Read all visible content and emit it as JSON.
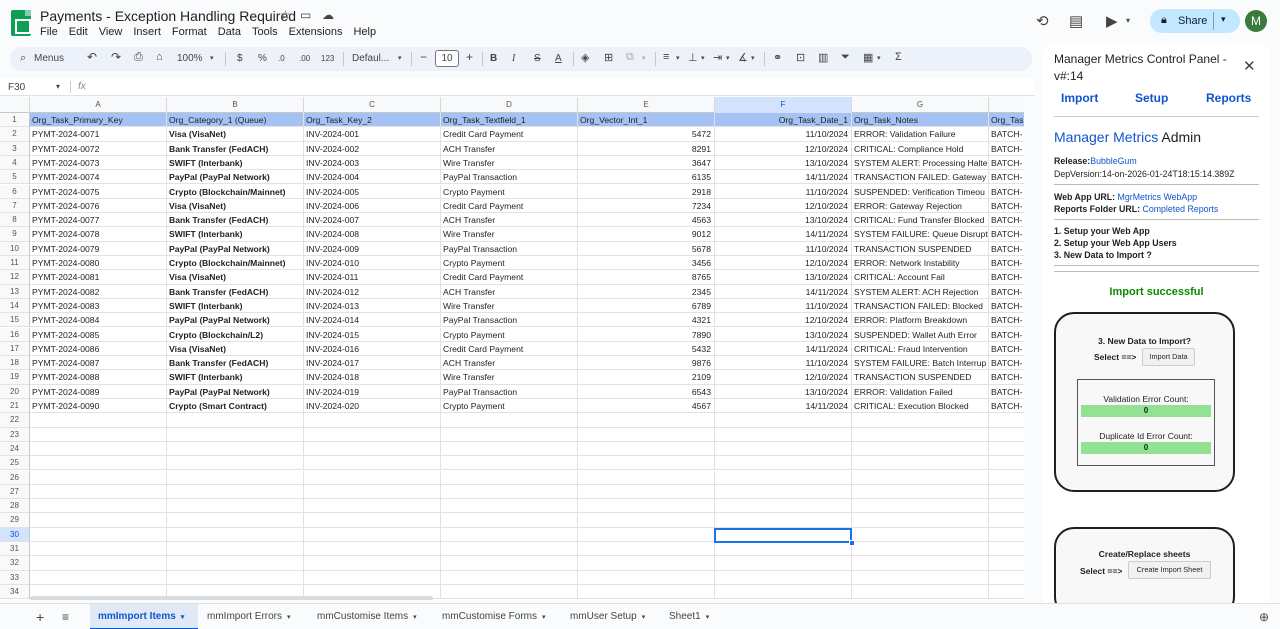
{
  "app": {
    "doc_title": "Payments - Exception Handling Required",
    "menus": [
      "File",
      "Edit",
      "View",
      "Insert",
      "Format",
      "Data",
      "Tools",
      "Extensions",
      "Help"
    ],
    "share_label": "Share",
    "avatar_letter": "M"
  },
  "toolbar": {
    "menus_search": "Menus",
    "zoom": "100%",
    "currency": "$",
    "percent": "%",
    "dec_decrease": ".0",
    "dec_increase": ".00",
    "number_format": "123",
    "font": "Defaul...",
    "font_size": "10",
    "bold": "B",
    "italic": "I",
    "strike": "S",
    "text_color_glyph": "A",
    "sum": "Σ",
    "icons": [
      "undo-icon",
      "redo-icon",
      "print-icon",
      "paint-format-icon",
      "zoom-dropdown-icon",
      "currency-icon",
      "percent-icon",
      "font-size-decrease-icon",
      "font-size-increase-icon",
      "bold-icon",
      "italic-icon",
      "strikethrough-icon",
      "text-color-icon",
      "fill-color-icon",
      "borders-icon",
      "merge-cells-icon",
      "align-icon",
      "valign-icon",
      "wrap-icon",
      "rotate-icon",
      "link-icon",
      "comment-icon",
      "chart-icon",
      "filter-icon",
      "filter-views-icon",
      "functions-icon"
    ]
  },
  "formula_bar": {
    "name_box": "F30",
    "fx": "fx",
    "formula": ""
  },
  "grid": {
    "columns": [
      "A",
      "B",
      "C",
      "D",
      "E",
      "F",
      "G"
    ],
    "partial_column": "",
    "row_numbers": [
      "1",
      "2",
      "3",
      "4",
      "5",
      "6",
      "7",
      "8",
      "9",
      "10",
      "11",
      "12",
      "13",
      "14",
      "15",
      "16",
      "17",
      "18",
      "19",
      "20",
      "21",
      "22",
      "23",
      "24",
      "25",
      "26",
      "27",
      "28",
      "29",
      "30",
      "31",
      "32",
      "33",
      "34"
    ],
    "headers": [
      "Org_Task_Primary_Key",
      "Org_Category_1 (Queue)",
      "Org_Task_Key_2",
      "Org_Task_Textfield_1",
      "Org_Vector_Int_1",
      "Org_Task_Date_1",
      "Org_Task_Notes",
      "Org_Tas"
    ],
    "rows": [
      [
        "PYMT-2024-0071",
        "Visa (VisaNet)",
        "INV-2024-001",
        "Credit Card Payment",
        "5472",
        "11/10/2024",
        "ERROR: Validation Failure",
        "BATCH-"
      ],
      [
        "PYMT-2024-0072",
        "Bank Transfer (FedACH)",
        "INV-2024-002",
        "ACH Transfer",
        "8291",
        "12/10/2024",
        "CRITICAL: Compliance Hold",
        "BATCH-"
      ],
      [
        "PYMT-2024-0073",
        "SWIFT (Interbank)",
        "INV-2024-003",
        "Wire Transfer",
        "3647",
        "13/10/2024",
        "SYSTEM ALERT: Processing Halte",
        "BATCH-"
      ],
      [
        "PYMT-2024-0074",
        "PayPal (PayPal Network)",
        "INV-2024-004",
        "PayPal Transaction",
        "6135",
        "14/11/2024",
        "TRANSACTION FAILED: Gateway",
        "BATCH-"
      ],
      [
        "PYMT-2024-0075",
        "Crypto (Blockchain/Mainnet)",
        "INV-2024-005",
        "Crypto Payment",
        "2918",
        "11/10/2024",
        "SUSPENDED: Verification Timeou",
        "BATCH-"
      ],
      [
        "PYMT-2024-0076",
        "Visa (VisaNet)",
        "INV-2024-006",
        "Credit Card Payment",
        "7234",
        "12/10/2024",
        "ERROR: Gateway Rejection",
        "BATCH-"
      ],
      [
        "PYMT-2024-0077",
        "Bank Transfer (FedACH)",
        "INV-2024-007",
        "ACH Transfer",
        "4563",
        "13/10/2024",
        "CRITICAL: Fund Transfer Blocked",
        "BATCH-"
      ],
      [
        "PYMT-2024-0078",
        "SWIFT (Interbank)",
        "INV-2024-008",
        "Wire Transfer",
        "9012",
        "14/11/2024",
        "SYSTEM FAILURE: Queue Disrupt",
        "BATCH-"
      ],
      [
        "PYMT-2024-0079",
        "PayPal (PayPal Network)",
        "INV-2024-009",
        "PayPal Transaction",
        "5678",
        "11/10/2024",
        "TRANSACTION SUSPENDED",
        "BATCH-"
      ],
      [
        "PYMT-2024-0080",
        "Crypto (Blockchain/Mainnet)",
        "INV-2024-010",
        "Crypto Payment",
        "3456",
        "12/10/2024",
        "ERROR: Network Instability",
        "BATCH-"
      ],
      [
        "PYMT-2024-0081",
        "Visa (VisaNet)",
        "INV-2024-011",
        "Credit Card Payment",
        "8765",
        "13/10/2024",
        "CRITICAL: Account Fail",
        "BATCH-"
      ],
      [
        "PYMT-2024-0082",
        "Bank Transfer (FedACH)",
        "INV-2024-012",
        "ACH Transfer",
        "2345",
        "14/11/2024",
        "SYSTEM ALERT: ACH Rejection",
        "BATCH-"
      ],
      [
        "PYMT-2024-0083",
        "SWIFT (Interbank)",
        "INV-2024-013",
        "Wire Transfer",
        "6789",
        "11/10/2024",
        "TRANSACTION FAILED: Blocked",
        "BATCH-"
      ],
      [
        "PYMT-2024-0084",
        "PayPal (PayPal Network)",
        "INV-2024-014",
        "PayPal Transaction",
        "4321",
        "12/10/2024",
        "ERROR: Platform Breakdown",
        "BATCH-"
      ],
      [
        "PYMT-2024-0085",
        "Crypto (Blockchain/L2)",
        "INV-2024-015",
        "Crypto Payment",
        "7890",
        "13/10/2024",
        "SUSPENDED: Wallet Auth Error",
        "BATCH-"
      ],
      [
        "PYMT-2024-0086",
        "Visa (VisaNet)",
        "INV-2024-016",
        "Credit Card Payment",
        "5432",
        "14/11/2024",
        "CRITICAL: Fraud Intervention",
        "BATCH-"
      ],
      [
        "PYMT-2024-0087",
        "Bank Transfer (FedACH)",
        "INV-2024-017",
        "ACH Transfer",
        "9876",
        "11/10/2024",
        "SYSTEM FAILURE: Batch Interrup",
        "BATCH-"
      ],
      [
        "PYMT-2024-0088",
        "SWIFT (Interbank)",
        "INV-2024-018",
        "Wire Transfer",
        "2109",
        "12/10/2024",
        "TRANSACTION SUSPENDED",
        "BATCH-"
      ],
      [
        "PYMT-2024-0089",
        "PayPal (PayPal Network)",
        "INV-2024-019",
        "PayPal Transaction",
        "6543",
        "13/10/2024",
        "ERROR: Validation Failed",
        "BATCH-"
      ],
      [
        "PYMT-2024-0090",
        "Crypto (Smart Contract)",
        "INV-2024-020",
        "Crypto Payment",
        "4567",
        "14/11/2024",
        "CRITICAL: Execution Blocked",
        "BATCH-"
      ]
    ],
    "header_fill": "#a4c2f4",
    "selected_cell": "F30"
  },
  "sheet_tabs": [
    "mmImport Items",
    "mmImport Errors",
    "mmCustomise Items",
    "mmCustomise Forms",
    "mmUser Setup",
    "Sheet1"
  ],
  "active_tab": "mmImport Items",
  "panel": {
    "title": "Manager Metrics Control Panel - v#:14",
    "nav": [
      "Import",
      "Setup",
      "Reports"
    ],
    "admin_brand": "Manager Metrics",
    "admin_suffix": "Admin",
    "release_label": "Release:",
    "release_value": "BubbleGum",
    "dep_version": "DepVersion:14-on-2026-01-24T18:15:14.389Z",
    "webapp_label": "Web App URL:",
    "webapp_link": "MgrMetrics WebApp",
    "reports_label": "Reports Folder URL:",
    "reports_link": "Completed Reports",
    "steps": [
      "1. Setup your Web App",
      "2. Setup your Web App Users",
      "3. New Data to Import ?"
    ],
    "import_status": "Import successful",
    "card1_title": "3. New Data to Import?",
    "card1_select": "Select ==>",
    "card1_button": "Import Data",
    "validation_label": "Validation Error Count:",
    "validation_value": "0",
    "duplicate_label": "Duplicate Id Error Count:",
    "duplicate_value": "0",
    "card2_title": "Create/Replace sheets",
    "card2_select": "Select ==>",
    "card2_button": "Create Import Sheet"
  }
}
